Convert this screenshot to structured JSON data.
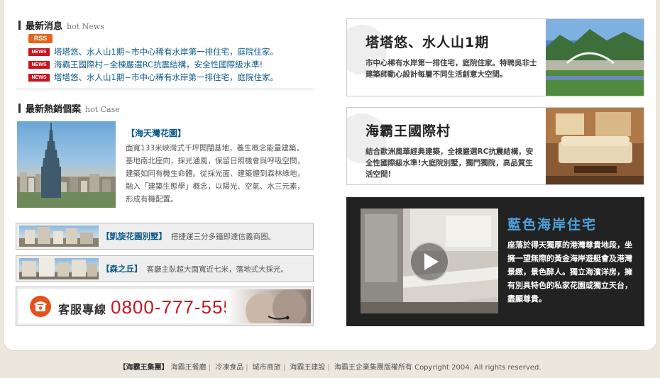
{
  "news": {
    "title": "最新消息",
    "title_en": "hot News",
    "rss_label": "RSS",
    "badge_label": "NEWS",
    "items": [
      "塔塔悠、水人山1期~市中心稀有水岸第一排住宅，庭院住家。",
      "海霸王國際村~全棟嚴選RC抗震結構，安全性國際級水準!",
      "塔塔悠、水人山1期~市中心稀有水岸第一排住宅，庭院住家。"
    ]
  },
  "cases": {
    "title": "最新熱銷個案",
    "title_en": "hot Case",
    "featured": {
      "title": "【海天灣花園】",
      "desc": "面寬133米峽灣式千坪開闊基地，養生概念能量建築。基地南北座向，採光通風，保留日照機會與呼吸空間，建築如同有機生命體。從採光面、建築體到森林綠地，融入「建築生態學」概念，以陽光、空氣、水三元素，形成有機配置。"
    },
    "list": [
      {
        "title": "【凱旋花園別墅】",
        "desc": "搭捷運三分多鐘即達信義商圈。"
      },
      {
        "title": "【森之丘】",
        "desc": "客廳主臥超大面寬近七米，落地式大採光。"
      }
    ]
  },
  "service": {
    "label": "客服專線",
    "number": "0800-777-555"
  },
  "promos": [
    {
      "title": "塔塔悠、水人山1期",
      "desc": "市中心稀有水岸第一排住宅，庭院住家。特聘吳非士建築師動心設計每層不同生活創意大空間。"
    },
    {
      "title": "海霸王國際村",
      "desc": "結合歐洲風華經典建築，全棟嚴選RC抗震結構，安全性國際級水準!大庭院別墅，獨門獨院，高品質生活空間!"
    }
  ],
  "video": {
    "title": "藍色海岸住宅",
    "desc": "座落於得天獨厚的港灣尊貴地段，坐擁一望無際的黃金海岸遊艇會及港灣景緻，景色醉人。獨立海濱洋房，擁有別具特色的私家花園或獨立天台，盡顯尊貴。"
  },
  "footer": {
    "brand": "【海霸王集團】",
    "links": [
      "海霸王餐廳",
      "冷凍食品",
      "城市商旅",
      "海霸王建設"
    ],
    "copyright": "海霸王企業集團版權所有 Copyright 2004. All rights reserved."
  },
  "colors": {
    "link_blue": "#0c5a8a",
    "badge_red": "#c8141e",
    "rss_orange": "#e8641c",
    "video_title_blue": "#4fa0dc"
  }
}
